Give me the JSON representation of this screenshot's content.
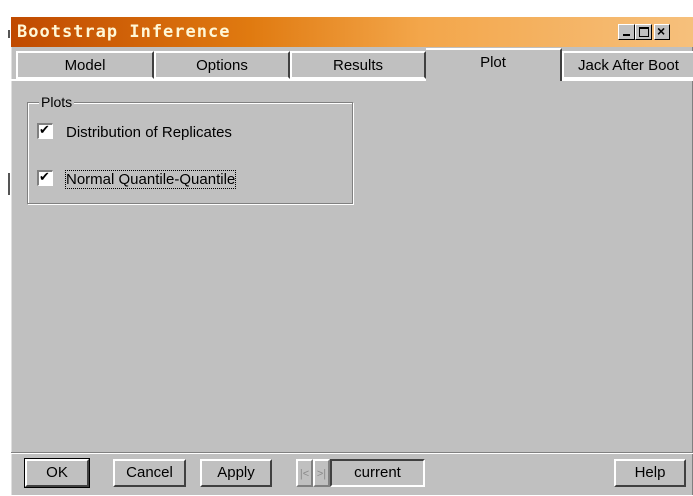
{
  "window": {
    "title": "Bootstrap Inference"
  },
  "tabs": [
    {
      "label": "Model",
      "active": false
    },
    {
      "label": "Options",
      "active": false
    },
    {
      "label": "Results",
      "active": false
    },
    {
      "label": "Plot",
      "active": true
    },
    {
      "label": "Jack After Boot",
      "active": false
    }
  ],
  "plots_group": {
    "label": "Plots",
    "options": [
      {
        "label": "Distribution of Replicates",
        "checked": true
      },
      {
        "label": "Normal Quantile-Quantile",
        "checked": true
      }
    ]
  },
  "bottom_bar": {
    "ok_label": "OK",
    "cancel_label": "Cancel",
    "apply_label": "Apply",
    "prev_glyph": "|<",
    "next_glyph": ">|",
    "current_label": "current",
    "help_label": "Help"
  },
  "icons": [
    "minimize-icon",
    "maximize-icon",
    "close-icon",
    "checkmark-icon",
    "first-record-icon",
    "next-record-icon"
  ],
  "colors": {
    "titlebar_start": "#c04a00",
    "titlebar_end": "#f6c07c",
    "title_text": "#fff7d6",
    "face": "#c0c0c0"
  }
}
